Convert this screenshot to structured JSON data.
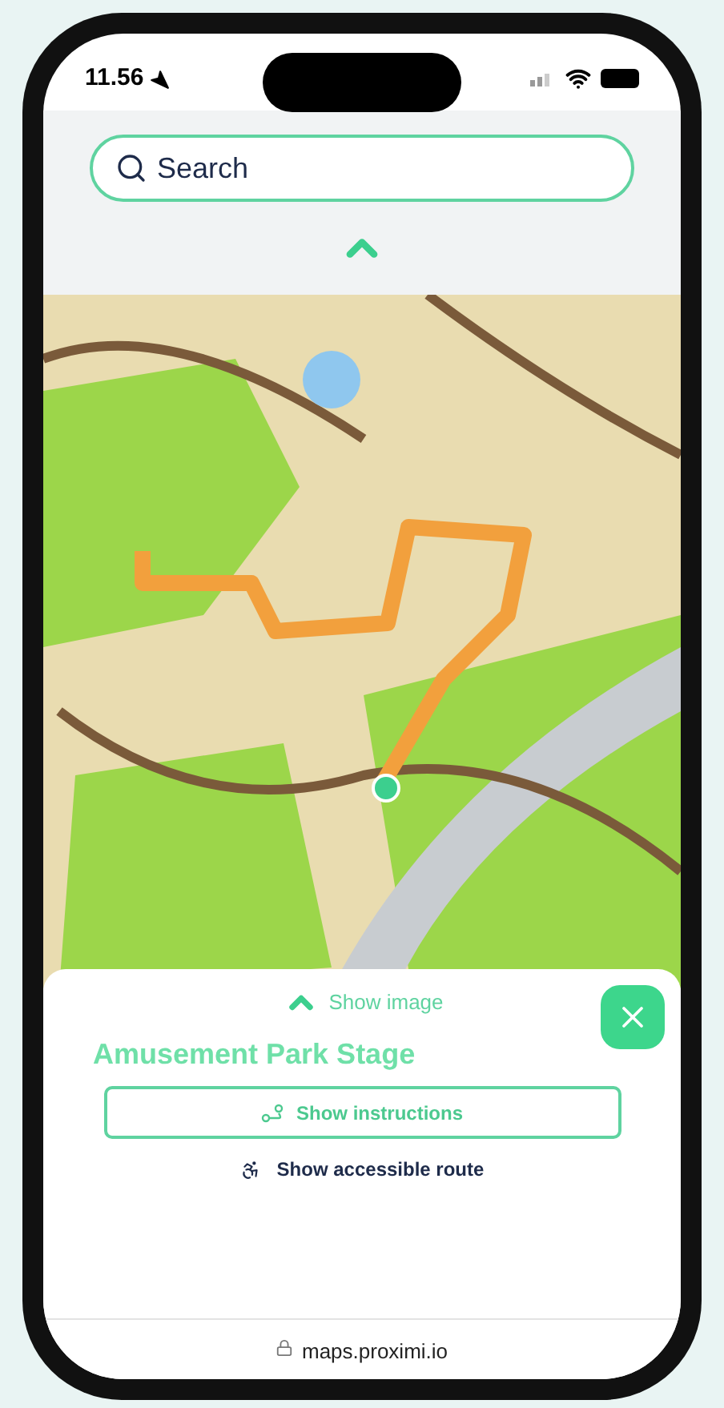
{
  "status_bar": {
    "time": "11.56"
  },
  "search": {
    "placeholder": "Search"
  },
  "sheet": {
    "toggle_label": "Show image",
    "title": "Amusement Park Stage",
    "primary_button": "Show instructions",
    "secondary_button": "Show accessible route"
  },
  "browser": {
    "url": "maps.proximi.io"
  }
}
